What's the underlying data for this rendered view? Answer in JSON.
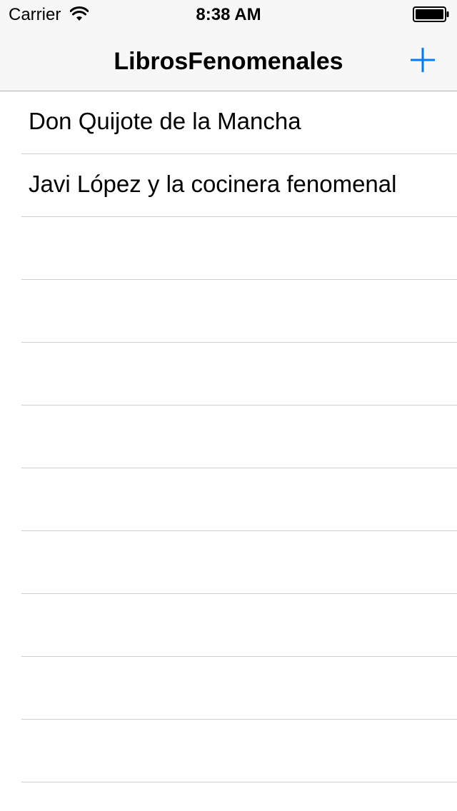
{
  "status_bar": {
    "carrier": "Carrier",
    "time": "8:38 AM",
    "wifi_icon": "wifi-icon",
    "battery_icon": "battery-icon"
  },
  "nav_bar": {
    "title": "LibrosFenomenales",
    "add_icon": "plus-icon",
    "accent_color": "#007aff"
  },
  "books": [
    {
      "title": "Don Quijote de la Mancha"
    },
    {
      "title": "Javi López y la cocinera fenomenal"
    }
  ]
}
